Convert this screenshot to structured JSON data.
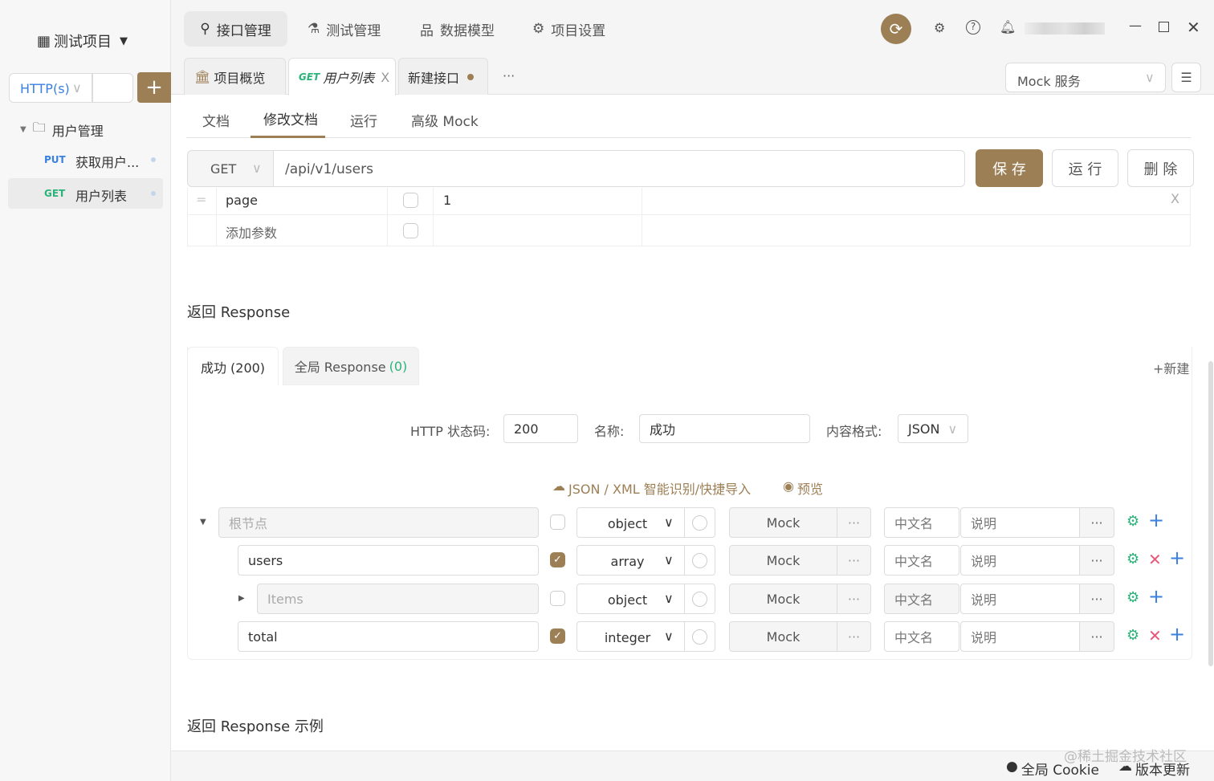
{
  "sidebar": {
    "project": "测试项目",
    "protocol": "HTTP(s)",
    "group": "用户管理",
    "items": [
      {
        "method": "PUT",
        "label": "获取用户..."
      },
      {
        "method": "GET",
        "label": "用户列表"
      }
    ]
  },
  "topnav": {
    "items": [
      "接口管理",
      "测试管理",
      "数据模型",
      "项目设置"
    ]
  },
  "tabs": {
    "overview": "项目概览",
    "active_method": "GET",
    "active": "用户列表",
    "new": "新建接口",
    "more": "···",
    "close": "X"
  },
  "mock_select": "Mock 服务",
  "subtabs": [
    "文档",
    "修改文档",
    "运行",
    "高级 Mock"
  ],
  "request": {
    "method": "GET",
    "url": "/api/v1/users",
    "save": "保 存",
    "run": "运 行",
    "delete": "删 除"
  },
  "params": [
    {
      "name": "page",
      "value": "1"
    },
    {
      "name": "添加参数",
      "value": ""
    }
  ],
  "response": {
    "title": "返回 Response",
    "tab_success": "成功 (200)",
    "tab_global": "全局 Response",
    "tab_global_count": "(0)",
    "new": "+新建",
    "status_label": "HTTP 状态码:",
    "status": "200",
    "name_label": "名称:",
    "name": "成功",
    "format_label": "内容格式:",
    "format": "JSON",
    "import": "JSON / XML 智能识别/快捷导入",
    "preview": "预览",
    "rows": [
      {
        "name": "根节点",
        "placeholder": true,
        "required": false,
        "type": "object",
        "removable": false
      },
      {
        "name": "users",
        "placeholder": false,
        "required": true,
        "type": "array",
        "removable": true
      },
      {
        "name": "Items",
        "placeholder": true,
        "required": false,
        "type": "object",
        "removable": false
      },
      {
        "name": "total",
        "placeholder": false,
        "required": true,
        "type": "integer",
        "removable": true
      }
    ],
    "mock": "Mock",
    "cn": "中文名",
    "desc": "说明",
    "dots": "···"
  },
  "example_title": "返回 Response 示例",
  "footer": {
    "cookie": "全局 Cookie",
    "update": "版本更新",
    "watermark": "@稀土掘金技术社区"
  },
  "colors": {
    "accent": "#9c7f55",
    "get": "#2bb37a",
    "put": "#3a80e0",
    "delete": "#e8587a"
  }
}
